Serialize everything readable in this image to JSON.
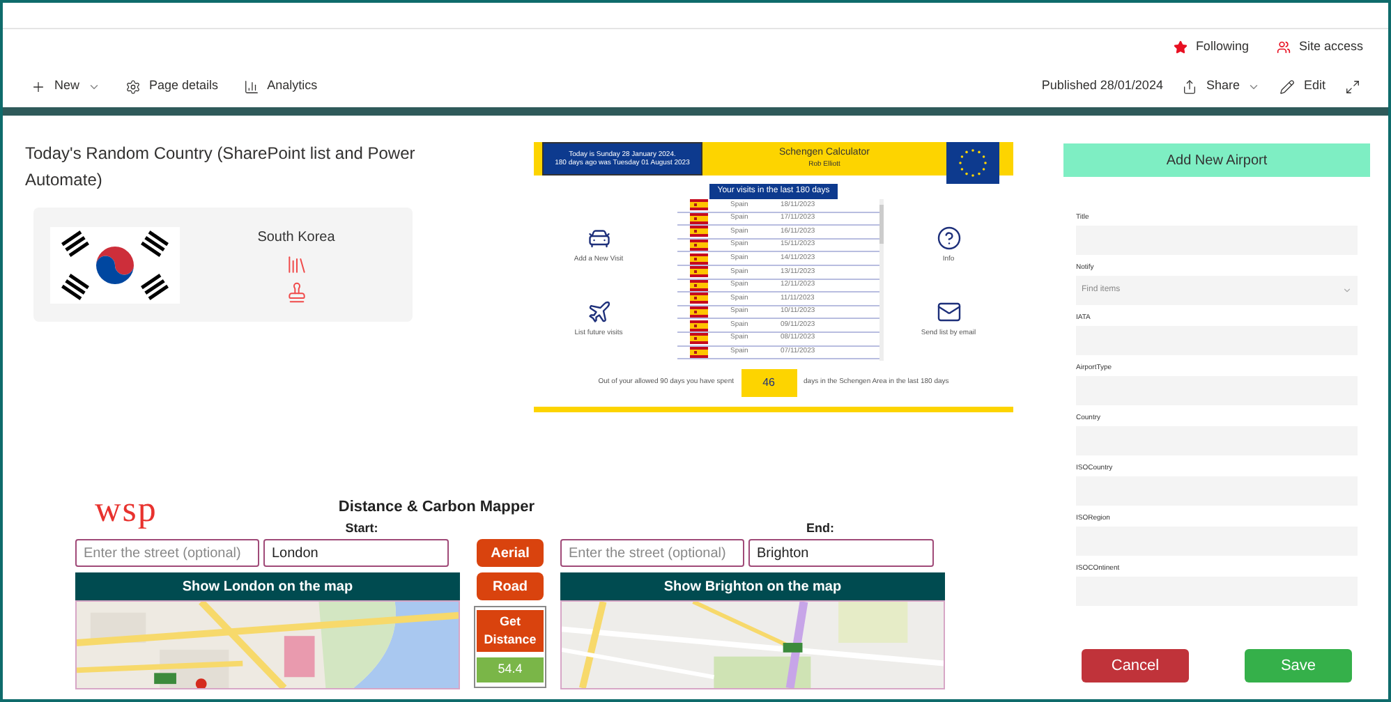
{
  "top_bar": {
    "following": "Following",
    "site_access": "Site access"
  },
  "command_bar": {
    "items": [
      {
        "label": "New",
        "kind": "new"
      },
      {
        "label": "Page details",
        "kind": "details"
      },
      {
        "label": "Analytics",
        "kind": "analytics"
      }
    ],
    "published": "Published 28/01/2024",
    "share": "Share",
    "edit": "Edit"
  },
  "random_country": {
    "title": "Today's Random Country (SharePoint list and Power Automate)",
    "country": "South Korea"
  },
  "schengen": {
    "today_text": "Today is Sunday 28 January 2024.",
    "ago_text": "180 days ago was Tuesday 01 August 2023",
    "title": "Schengen Calculator",
    "author": "Rob Elliott",
    "visits_heading": "Your visits in the last 180 days",
    "left_actions": [
      {
        "label": "Add a New Visit",
        "kind": "car"
      },
      {
        "label": "List future visits",
        "kind": "plane"
      }
    ],
    "right_actions": [
      {
        "label": "Info",
        "kind": "help"
      },
      {
        "label": "Send list by email",
        "kind": "mail"
      }
    ],
    "visits": [
      {
        "country": "Spain",
        "date": "18/11/2023"
      },
      {
        "country": "Spain",
        "date": "17/11/2023"
      },
      {
        "country": "Spain",
        "date": "16/11/2023"
      },
      {
        "country": "Spain",
        "date": "15/11/2023"
      },
      {
        "country": "Spain",
        "date": "14/11/2023"
      },
      {
        "country": "Spain",
        "date": "13/11/2023"
      },
      {
        "country": "Spain",
        "date": "12/11/2023"
      },
      {
        "country": "Spain",
        "date": "11/11/2023"
      },
      {
        "country": "Spain",
        "date": "10/11/2023"
      },
      {
        "country": "Spain",
        "date": "09/11/2023"
      },
      {
        "country": "Spain",
        "date": "08/11/2023"
      },
      {
        "country": "Spain",
        "date": "07/11/2023"
      }
    ],
    "summary_before": "Out of your allowed 90 days you have spent",
    "days": "46",
    "summary_after": "days in the Schengen Area in the last 180 days"
  },
  "airport_form": {
    "title": "Add New Airport",
    "fields": [
      {
        "label": "Title",
        "kind": "text"
      },
      {
        "label": "Notify",
        "kind": "lookup",
        "placeholder": "Find items"
      },
      {
        "label": "IATA",
        "kind": "text"
      },
      {
        "label": "AirportType",
        "kind": "text"
      },
      {
        "label": "Country",
        "kind": "text"
      },
      {
        "label": "ISOCountry",
        "kind": "text"
      },
      {
        "label": "ISORegion",
        "kind": "text"
      },
      {
        "label": "ISOCOntinent",
        "kind": "text"
      }
    ],
    "buttons": [
      {
        "label": "Cancel",
        "kind": "cancel"
      },
      {
        "label": "Save",
        "kind": "save"
      }
    ]
  },
  "mapper": {
    "logo": "wsp",
    "title": "Distance & Carbon Mapper",
    "start": {
      "label": "Start:",
      "street_placeholder": "Enter the street (optional)",
      "city": "London",
      "show_button": "Show London on the map"
    },
    "end": {
      "label": "End:",
      "street_placeholder": "Enter the street (optional)",
      "city": "Brighton",
      "show_button": "Show Brighton on the map"
    },
    "view_buttons": [
      "Aerial",
      "Road"
    ],
    "get_distance": "Get Distance",
    "distance": "54.4"
  }
}
